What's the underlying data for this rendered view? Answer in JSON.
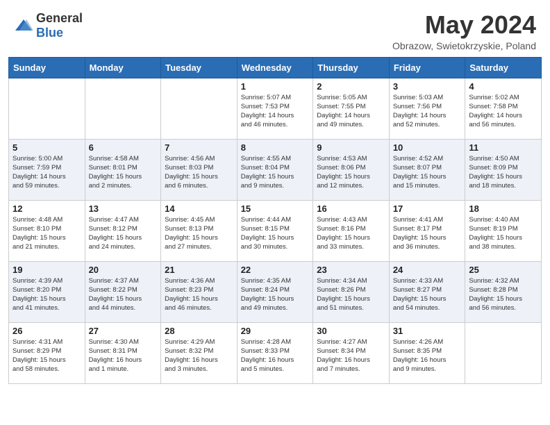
{
  "header": {
    "logo_general": "General",
    "logo_blue": "Blue",
    "title": "May 2024",
    "subtitle": "Obrazow, Swietokrzyskie, Poland"
  },
  "days_of_week": [
    "Sunday",
    "Monday",
    "Tuesday",
    "Wednesday",
    "Thursday",
    "Friday",
    "Saturday"
  ],
  "weeks": [
    [
      {
        "day": "",
        "lines": []
      },
      {
        "day": "",
        "lines": []
      },
      {
        "day": "",
        "lines": []
      },
      {
        "day": "1",
        "lines": [
          "Sunrise: 5:07 AM",
          "Sunset: 7:53 PM",
          "Daylight: 14 hours",
          "and 46 minutes."
        ]
      },
      {
        "day": "2",
        "lines": [
          "Sunrise: 5:05 AM",
          "Sunset: 7:55 PM",
          "Daylight: 14 hours",
          "and 49 minutes."
        ]
      },
      {
        "day": "3",
        "lines": [
          "Sunrise: 5:03 AM",
          "Sunset: 7:56 PM",
          "Daylight: 14 hours",
          "and 52 minutes."
        ]
      },
      {
        "day": "4",
        "lines": [
          "Sunrise: 5:02 AM",
          "Sunset: 7:58 PM",
          "Daylight: 14 hours",
          "and 56 minutes."
        ]
      }
    ],
    [
      {
        "day": "5",
        "lines": [
          "Sunrise: 5:00 AM",
          "Sunset: 7:59 PM",
          "Daylight: 14 hours",
          "and 59 minutes."
        ]
      },
      {
        "day": "6",
        "lines": [
          "Sunrise: 4:58 AM",
          "Sunset: 8:01 PM",
          "Daylight: 15 hours",
          "and 2 minutes."
        ]
      },
      {
        "day": "7",
        "lines": [
          "Sunrise: 4:56 AM",
          "Sunset: 8:03 PM",
          "Daylight: 15 hours",
          "and 6 minutes."
        ]
      },
      {
        "day": "8",
        "lines": [
          "Sunrise: 4:55 AM",
          "Sunset: 8:04 PM",
          "Daylight: 15 hours",
          "and 9 minutes."
        ]
      },
      {
        "day": "9",
        "lines": [
          "Sunrise: 4:53 AM",
          "Sunset: 8:06 PM",
          "Daylight: 15 hours",
          "and 12 minutes."
        ]
      },
      {
        "day": "10",
        "lines": [
          "Sunrise: 4:52 AM",
          "Sunset: 8:07 PM",
          "Daylight: 15 hours",
          "and 15 minutes."
        ]
      },
      {
        "day": "11",
        "lines": [
          "Sunrise: 4:50 AM",
          "Sunset: 8:09 PM",
          "Daylight: 15 hours",
          "and 18 minutes."
        ]
      }
    ],
    [
      {
        "day": "12",
        "lines": [
          "Sunrise: 4:48 AM",
          "Sunset: 8:10 PM",
          "Daylight: 15 hours",
          "and 21 minutes."
        ]
      },
      {
        "day": "13",
        "lines": [
          "Sunrise: 4:47 AM",
          "Sunset: 8:12 PM",
          "Daylight: 15 hours",
          "and 24 minutes."
        ]
      },
      {
        "day": "14",
        "lines": [
          "Sunrise: 4:45 AM",
          "Sunset: 8:13 PM",
          "Daylight: 15 hours",
          "and 27 minutes."
        ]
      },
      {
        "day": "15",
        "lines": [
          "Sunrise: 4:44 AM",
          "Sunset: 8:15 PM",
          "Daylight: 15 hours",
          "and 30 minutes."
        ]
      },
      {
        "day": "16",
        "lines": [
          "Sunrise: 4:43 AM",
          "Sunset: 8:16 PM",
          "Daylight: 15 hours",
          "and 33 minutes."
        ]
      },
      {
        "day": "17",
        "lines": [
          "Sunrise: 4:41 AM",
          "Sunset: 8:17 PM",
          "Daylight: 15 hours",
          "and 36 minutes."
        ]
      },
      {
        "day": "18",
        "lines": [
          "Sunrise: 4:40 AM",
          "Sunset: 8:19 PM",
          "Daylight: 15 hours",
          "and 38 minutes."
        ]
      }
    ],
    [
      {
        "day": "19",
        "lines": [
          "Sunrise: 4:39 AM",
          "Sunset: 8:20 PM",
          "Daylight: 15 hours",
          "and 41 minutes."
        ]
      },
      {
        "day": "20",
        "lines": [
          "Sunrise: 4:37 AM",
          "Sunset: 8:22 PM",
          "Daylight: 15 hours",
          "and 44 minutes."
        ]
      },
      {
        "day": "21",
        "lines": [
          "Sunrise: 4:36 AM",
          "Sunset: 8:23 PM",
          "Daylight: 15 hours",
          "and 46 minutes."
        ]
      },
      {
        "day": "22",
        "lines": [
          "Sunrise: 4:35 AM",
          "Sunset: 8:24 PM",
          "Daylight: 15 hours",
          "and 49 minutes."
        ]
      },
      {
        "day": "23",
        "lines": [
          "Sunrise: 4:34 AM",
          "Sunset: 8:26 PM",
          "Daylight: 15 hours",
          "and 51 minutes."
        ]
      },
      {
        "day": "24",
        "lines": [
          "Sunrise: 4:33 AM",
          "Sunset: 8:27 PM",
          "Daylight: 15 hours",
          "and 54 minutes."
        ]
      },
      {
        "day": "25",
        "lines": [
          "Sunrise: 4:32 AM",
          "Sunset: 8:28 PM",
          "Daylight: 15 hours",
          "and 56 minutes."
        ]
      }
    ],
    [
      {
        "day": "26",
        "lines": [
          "Sunrise: 4:31 AM",
          "Sunset: 8:29 PM",
          "Daylight: 15 hours",
          "and 58 minutes."
        ]
      },
      {
        "day": "27",
        "lines": [
          "Sunrise: 4:30 AM",
          "Sunset: 8:31 PM",
          "Daylight: 16 hours",
          "and 1 minute."
        ]
      },
      {
        "day": "28",
        "lines": [
          "Sunrise: 4:29 AM",
          "Sunset: 8:32 PM",
          "Daylight: 16 hours",
          "and 3 minutes."
        ]
      },
      {
        "day": "29",
        "lines": [
          "Sunrise: 4:28 AM",
          "Sunset: 8:33 PM",
          "Daylight: 16 hours",
          "and 5 minutes."
        ]
      },
      {
        "day": "30",
        "lines": [
          "Sunrise: 4:27 AM",
          "Sunset: 8:34 PM",
          "Daylight: 16 hours",
          "and 7 minutes."
        ]
      },
      {
        "day": "31",
        "lines": [
          "Sunrise: 4:26 AM",
          "Sunset: 8:35 PM",
          "Daylight: 16 hours",
          "and 9 minutes."
        ]
      },
      {
        "day": "",
        "lines": []
      }
    ]
  ]
}
